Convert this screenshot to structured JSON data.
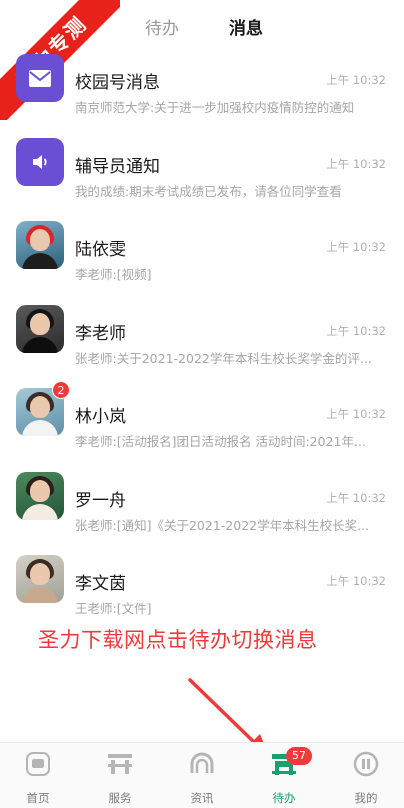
{
  "tabs": {
    "todo": "待办",
    "messages": "消息"
  },
  "watermark": "圣力专测",
  "messages": [
    {
      "title": "校园号消息",
      "time": "上午 10:32",
      "preview": "南京师范大学:关于进一步加强校内疫情防控的通知",
      "avatar_icon": "mail-icon"
    },
    {
      "title": "辅导员通知",
      "time": "上午 10:32",
      "preview": "我的成绩:期末考试成绩已发布，请各位同学查看",
      "avatar_icon": "speaker-icon"
    },
    {
      "title": "陆依雯",
      "time": "上午 10:32",
      "preview": "李老师:[视频]"
    },
    {
      "title": "李老师",
      "time": "上午 10:32",
      "preview": "张老师:关于2021-2022学年本科生校长奖学金的评..."
    },
    {
      "title": "林小岚",
      "time": "上午 10:32",
      "preview": "李老师:[活动报名]团日活动报名 活动时间:2021年...",
      "badge": "2"
    },
    {
      "title": "罗一舟",
      "time": "上午 10:32",
      "preview": "张老师:[通知]《关于2021-2022学年本科生校长奖..."
    },
    {
      "title": "李文茵",
      "time": "上午 10:32",
      "preview": "王老师:[文件]"
    }
  ],
  "annotation": "圣力下载网点击待办切换消息",
  "nav": {
    "home": "首页",
    "services": "服务",
    "news": "资讯",
    "todo": "待办",
    "todo_badge": "57",
    "mine": "我的"
  },
  "colors": {
    "accent_green": "#1aa06d",
    "system_avatar": "#6a4fd4",
    "badge_red": "#ee3a3a",
    "ribbon_red": "#e8221b"
  }
}
